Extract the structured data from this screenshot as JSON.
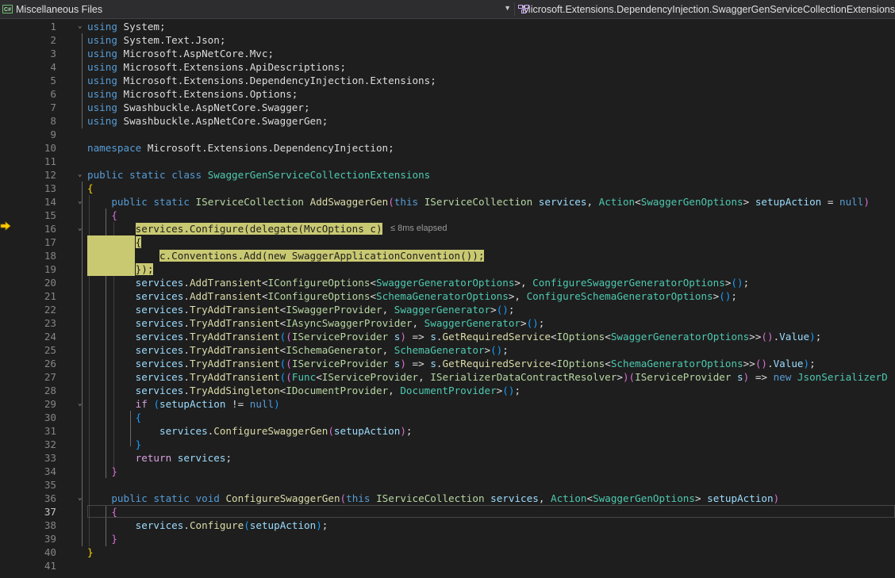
{
  "nav": {
    "left_label": "Miscellaneous Files",
    "left_icon": "csharp-file-icon",
    "right_label": "Microsoft.Extensions.DependencyInjection.SwaggerGenServiceCollectionExtensions",
    "right_icon": "class-icon"
  },
  "editor": {
    "current_line": 37,
    "elapsed_hint": "≤ 8ms elapsed",
    "lines": [
      "1",
      "2",
      "3",
      "4",
      "5",
      "6",
      "7",
      "8",
      "9",
      "10",
      "11",
      "12",
      "13",
      "14",
      "15",
      "16",
      "17",
      "18",
      "19",
      "20",
      "21",
      "22",
      "23",
      "24",
      "25",
      "26",
      "27",
      "28",
      "29",
      "30",
      "31",
      "32",
      "33",
      "34",
      "35",
      "36",
      "37",
      "38",
      "39",
      "40",
      "41"
    ],
    "code": {
      "l1": [
        "using",
        " System;"
      ],
      "l2": [
        "using",
        " System.Text.Json;"
      ],
      "l3": [
        "using",
        " Microsoft.AspNetCore.Mvc;"
      ],
      "l4": [
        "using",
        " Microsoft.Extensions.ApiDescriptions;"
      ],
      "l5": [
        "using",
        " Microsoft.Extensions.DependencyInjection.Extensions;"
      ],
      "l6": [
        "using",
        " Microsoft.Extensions.Options;"
      ],
      "l7": [
        "using",
        " Swashbuckle.AspNetCore.Swagger;"
      ],
      "l8": [
        "using",
        " Swashbuckle.AspNetCore.SwaggerGen;"
      ],
      "l10": [
        "namespace",
        " Microsoft.Extensions.DependencyInjection;"
      ],
      "l12": [
        "public",
        "static",
        "class",
        "SwaggerGenServiceCollectionExtensions"
      ],
      "l14": [
        "public",
        "static",
        "IServiceCollection",
        "AddSwaggerGen",
        "this",
        "IServiceCollection",
        "services",
        "Action",
        "SwaggerGenOptions",
        "setupAction",
        "null"
      ],
      "l16": "services.Configure(delegate(MvcOptions c)",
      "l17": "{",
      "l18": "c.Conventions.Add(new SwaggerApplicationConvention());",
      "l19": "});",
      "l20": [
        "services",
        ".",
        "AddTransient",
        "IConfigureOptions",
        "SwaggerGeneratorOptions",
        "ConfigureSwaggerGeneratorOptions"
      ],
      "l21": [
        "services",
        ".",
        "AddTransient",
        "IConfigureOptions",
        "SchemaGeneratorOptions",
        "ConfigureSchemaGeneratorOptions"
      ],
      "l22": [
        "services",
        ".",
        "TryAddTransient",
        "ISwaggerProvider",
        "SwaggerGenerator"
      ],
      "l23": [
        "services",
        ".",
        "TryAddTransient",
        "IAsyncSwaggerProvider",
        "SwaggerGenerator"
      ],
      "l24": [
        "services",
        "TryAddTransient",
        "IServiceProvider",
        "s",
        "s",
        "GetRequiredService",
        "IOptions",
        "SwaggerGeneratorOptions",
        "Value"
      ],
      "l25": [
        "services",
        "TryAddTransient",
        "ISchemaGenerator",
        "SchemaGenerator"
      ],
      "l26": [
        "services",
        "TryAddTransient",
        "IServiceProvider",
        "s",
        "s",
        "GetRequiredService",
        "IOptions",
        "SchemaGeneratorOptions",
        "Value"
      ],
      "l27": [
        "services",
        "TryAddTransient",
        "Func",
        "IServiceProvider",
        "ISerializerDataContractResolver",
        "IServiceProvider",
        "s",
        "new",
        "JsonSerializerD"
      ],
      "l28": [
        "services",
        "TryAddSingleton",
        "IDocumentProvider",
        "DocumentProvider"
      ],
      "l29": [
        "if",
        "setupAction",
        "!=",
        "null"
      ],
      "l31": [
        "services",
        "ConfigureSwaggerGen",
        "setupAction"
      ],
      "l33": [
        "return",
        "services"
      ],
      "l36": [
        "public",
        "static",
        "void",
        "ConfigureSwaggerGen",
        "this",
        "IServiceCollection",
        "services",
        "Action",
        "SwaggerGenOptions",
        "setupAction"
      ],
      "l38": [
        "services",
        "Configure",
        "setupAction"
      ]
    }
  },
  "colors": {
    "keyword": "#569cd6",
    "control": "#d8a0df",
    "type": "#4ec9b0",
    "interface": "#b8d7a3",
    "method": "#dcdcaa",
    "param": "#9cdcfe",
    "highlight": "#c9c972"
  }
}
